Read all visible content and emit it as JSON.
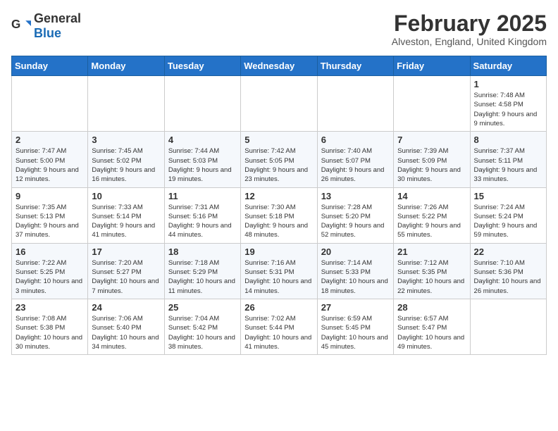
{
  "header": {
    "logo_general": "General",
    "logo_blue": "Blue",
    "month_title": "February 2025",
    "subtitle": "Alveston, England, United Kingdom"
  },
  "days_of_week": [
    "Sunday",
    "Monday",
    "Tuesday",
    "Wednesday",
    "Thursday",
    "Friday",
    "Saturday"
  ],
  "weeks": [
    [
      {
        "day": "",
        "info": ""
      },
      {
        "day": "",
        "info": ""
      },
      {
        "day": "",
        "info": ""
      },
      {
        "day": "",
        "info": ""
      },
      {
        "day": "",
        "info": ""
      },
      {
        "day": "",
        "info": ""
      },
      {
        "day": "1",
        "info": "Sunrise: 7:48 AM\nSunset: 4:58 PM\nDaylight: 9 hours and 9 minutes."
      }
    ],
    [
      {
        "day": "2",
        "info": "Sunrise: 7:47 AM\nSunset: 5:00 PM\nDaylight: 9 hours and 12 minutes."
      },
      {
        "day": "3",
        "info": "Sunrise: 7:45 AM\nSunset: 5:02 PM\nDaylight: 9 hours and 16 minutes."
      },
      {
        "day": "4",
        "info": "Sunrise: 7:44 AM\nSunset: 5:03 PM\nDaylight: 9 hours and 19 minutes."
      },
      {
        "day": "5",
        "info": "Sunrise: 7:42 AM\nSunset: 5:05 PM\nDaylight: 9 hours and 23 minutes."
      },
      {
        "day": "6",
        "info": "Sunrise: 7:40 AM\nSunset: 5:07 PM\nDaylight: 9 hours and 26 minutes."
      },
      {
        "day": "7",
        "info": "Sunrise: 7:39 AM\nSunset: 5:09 PM\nDaylight: 9 hours and 30 minutes."
      },
      {
        "day": "8",
        "info": "Sunrise: 7:37 AM\nSunset: 5:11 PM\nDaylight: 9 hours and 33 minutes."
      }
    ],
    [
      {
        "day": "9",
        "info": "Sunrise: 7:35 AM\nSunset: 5:13 PM\nDaylight: 9 hours and 37 minutes."
      },
      {
        "day": "10",
        "info": "Sunrise: 7:33 AM\nSunset: 5:14 PM\nDaylight: 9 hours and 41 minutes."
      },
      {
        "day": "11",
        "info": "Sunrise: 7:31 AM\nSunset: 5:16 PM\nDaylight: 9 hours and 44 minutes."
      },
      {
        "day": "12",
        "info": "Sunrise: 7:30 AM\nSunset: 5:18 PM\nDaylight: 9 hours and 48 minutes."
      },
      {
        "day": "13",
        "info": "Sunrise: 7:28 AM\nSunset: 5:20 PM\nDaylight: 9 hours and 52 minutes."
      },
      {
        "day": "14",
        "info": "Sunrise: 7:26 AM\nSunset: 5:22 PM\nDaylight: 9 hours and 55 minutes."
      },
      {
        "day": "15",
        "info": "Sunrise: 7:24 AM\nSunset: 5:24 PM\nDaylight: 9 hours and 59 minutes."
      }
    ],
    [
      {
        "day": "16",
        "info": "Sunrise: 7:22 AM\nSunset: 5:25 PM\nDaylight: 10 hours and 3 minutes."
      },
      {
        "day": "17",
        "info": "Sunrise: 7:20 AM\nSunset: 5:27 PM\nDaylight: 10 hours and 7 minutes."
      },
      {
        "day": "18",
        "info": "Sunrise: 7:18 AM\nSunset: 5:29 PM\nDaylight: 10 hours and 11 minutes."
      },
      {
        "day": "19",
        "info": "Sunrise: 7:16 AM\nSunset: 5:31 PM\nDaylight: 10 hours and 14 minutes."
      },
      {
        "day": "20",
        "info": "Sunrise: 7:14 AM\nSunset: 5:33 PM\nDaylight: 10 hours and 18 minutes."
      },
      {
        "day": "21",
        "info": "Sunrise: 7:12 AM\nSunset: 5:35 PM\nDaylight: 10 hours and 22 minutes."
      },
      {
        "day": "22",
        "info": "Sunrise: 7:10 AM\nSunset: 5:36 PM\nDaylight: 10 hours and 26 minutes."
      }
    ],
    [
      {
        "day": "23",
        "info": "Sunrise: 7:08 AM\nSunset: 5:38 PM\nDaylight: 10 hours and 30 minutes."
      },
      {
        "day": "24",
        "info": "Sunrise: 7:06 AM\nSunset: 5:40 PM\nDaylight: 10 hours and 34 minutes."
      },
      {
        "day": "25",
        "info": "Sunrise: 7:04 AM\nSunset: 5:42 PM\nDaylight: 10 hours and 38 minutes."
      },
      {
        "day": "26",
        "info": "Sunrise: 7:02 AM\nSunset: 5:44 PM\nDaylight: 10 hours and 41 minutes."
      },
      {
        "day": "27",
        "info": "Sunrise: 6:59 AM\nSunset: 5:45 PM\nDaylight: 10 hours and 45 minutes."
      },
      {
        "day": "28",
        "info": "Sunrise: 6:57 AM\nSunset: 5:47 PM\nDaylight: 10 hours and 49 minutes."
      },
      {
        "day": "",
        "info": ""
      }
    ]
  ]
}
